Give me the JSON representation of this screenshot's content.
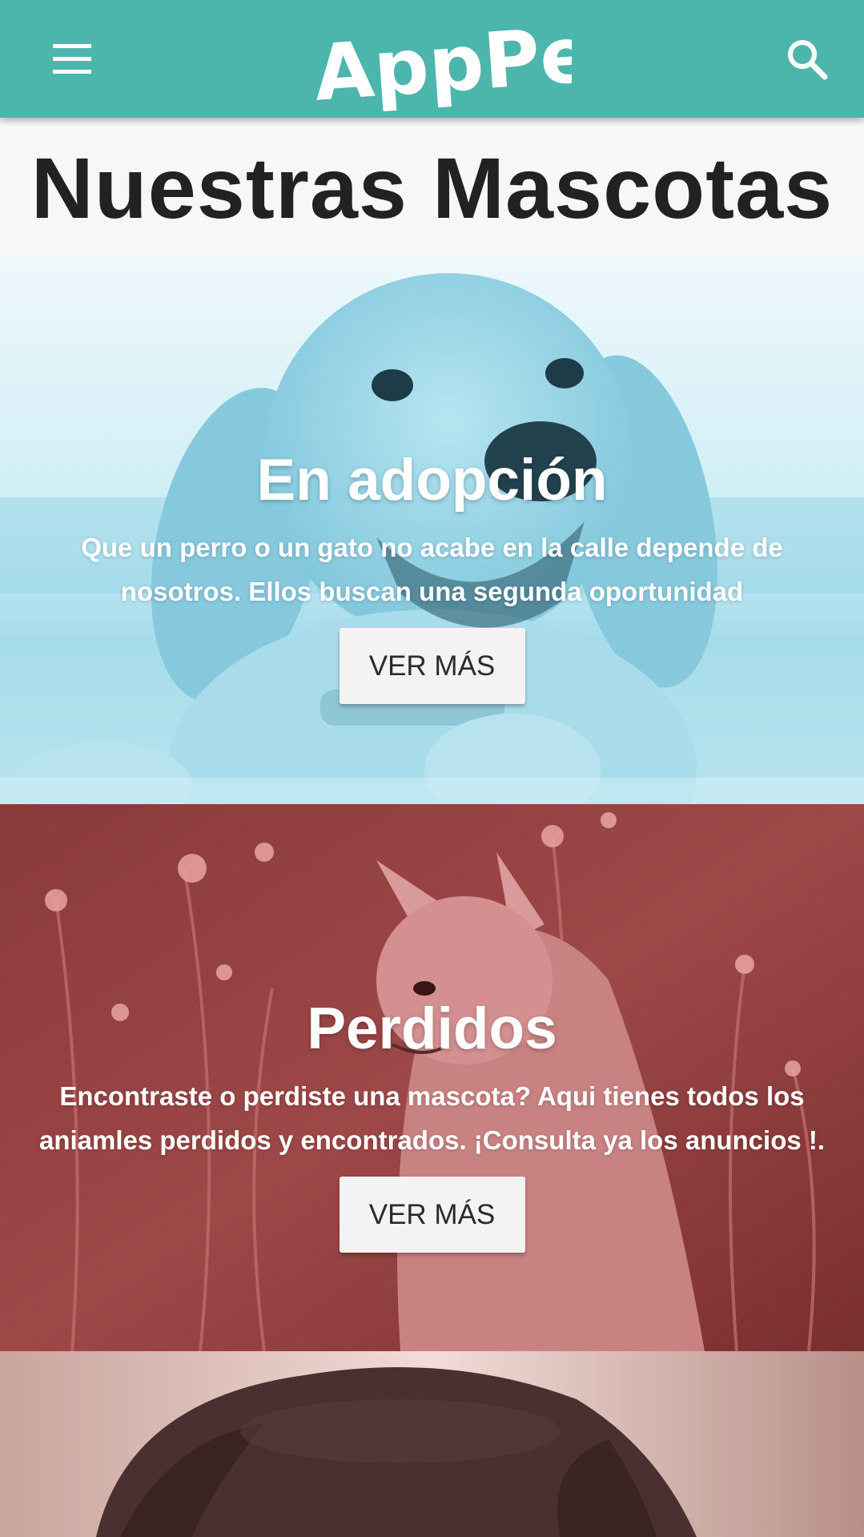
{
  "header": {
    "logo_text": "AppPet",
    "menu_icon": "menu-icon",
    "search_icon": "search-icon",
    "background_color": "#4db6ac"
  },
  "page": {
    "title": "Nuestras Mascotas"
  },
  "sections": [
    {
      "title": "En adopción",
      "description": "Que un perro o un gato no acabe en la calle depende de nosotros. Ellos buscan una segunda oportunidad",
      "button_label": "VER MÁS",
      "tint_color": "#a8dfec",
      "image_subject": "dog-puppy"
    },
    {
      "title": "Perdidos",
      "description": "Encontraste o perdiste una mascota? Aqui tienes todos los aniamles perdidos y encontrados. ¡Consulta ya los anuncios !.",
      "button_label": "VER MÁS",
      "tint_color": "#9a4444",
      "image_subject": "cat-in-flowers"
    },
    {
      "image_subject": "dog-head",
      "tint_color": "#b89088"
    }
  ]
}
